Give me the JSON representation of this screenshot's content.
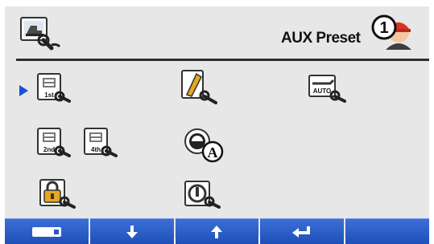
{
  "header": {
    "title": "AUX Preset",
    "operator_number": "1",
    "machine_icon": "excavator-settings-icon",
    "operator_icon": "operator-helmet-icon"
  },
  "menu": {
    "items": [
      {
        "name": "aux-preset-1st",
        "label": "1st",
        "icon": "attachment-1st-icon",
        "selected": true
      },
      {
        "name": "breaker-hammer",
        "icon": "breaker-wrench-icon"
      },
      {
        "name": "auto-setting",
        "label": "AUTO",
        "icon": "auto-wrench-icon"
      },
      {
        "name": "aux-preset-2nd",
        "label": "2nd",
        "icon": "attachment-2nd-icon"
      },
      {
        "name": "aux-preset-4th",
        "label": "4th",
        "icon": "attachment-4th-icon"
      },
      {
        "name": "flow-auto",
        "label": "A",
        "icon": "flow-auto-icon"
      },
      {
        "name": "lock",
        "icon": "lock-wrench-icon"
      },
      {
        "name": "power",
        "icon": "power-wrench-icon"
      }
    ]
  },
  "footer": {
    "buttons": [
      {
        "name": "menu-button",
        "icon": "menu-icon"
      },
      {
        "name": "down-button",
        "icon": "arrow-down-icon"
      },
      {
        "name": "up-button",
        "icon": "arrow-up-icon"
      },
      {
        "name": "enter-button",
        "icon": "enter-icon"
      },
      {
        "name": "blank-button",
        "icon": ""
      }
    ]
  },
  "colors": {
    "background": "#e7e7e7",
    "accent": "#1f4fb8",
    "cursor": "#1a4fd6"
  }
}
